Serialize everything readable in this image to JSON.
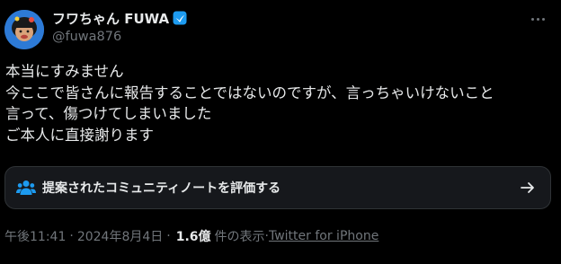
{
  "user": {
    "display_name": "フワちゃん FUWA",
    "handle": "@fuwa876",
    "verified": true,
    "verified_color": "#1d9bf0",
    "avatar_icon": "avatar-photo"
  },
  "body": {
    "lines": [
      "本当にすみません",
      "今ここで皆さんに報告することではないのですが、言っちゃいけないこと",
      "言って、傷つけてしまいました",
      "ご本人に直接謝ります"
    ]
  },
  "community_note": {
    "label": "提案されたコミュニティノートを評価する",
    "icon": "people-icon",
    "arrow_icon": "arrow-right-icon",
    "accent_color": "#1d9bf0"
  },
  "meta": {
    "time": "午後11:41",
    "sep1": "·",
    "date": "2024年8月4日",
    "sep2": "·",
    "views_count": "1.6億",
    "views_label": "件の表示",
    "sep3": "·",
    "source": "Twitter for iPhone"
  },
  "more_icon": "more-horizontal-icon"
}
